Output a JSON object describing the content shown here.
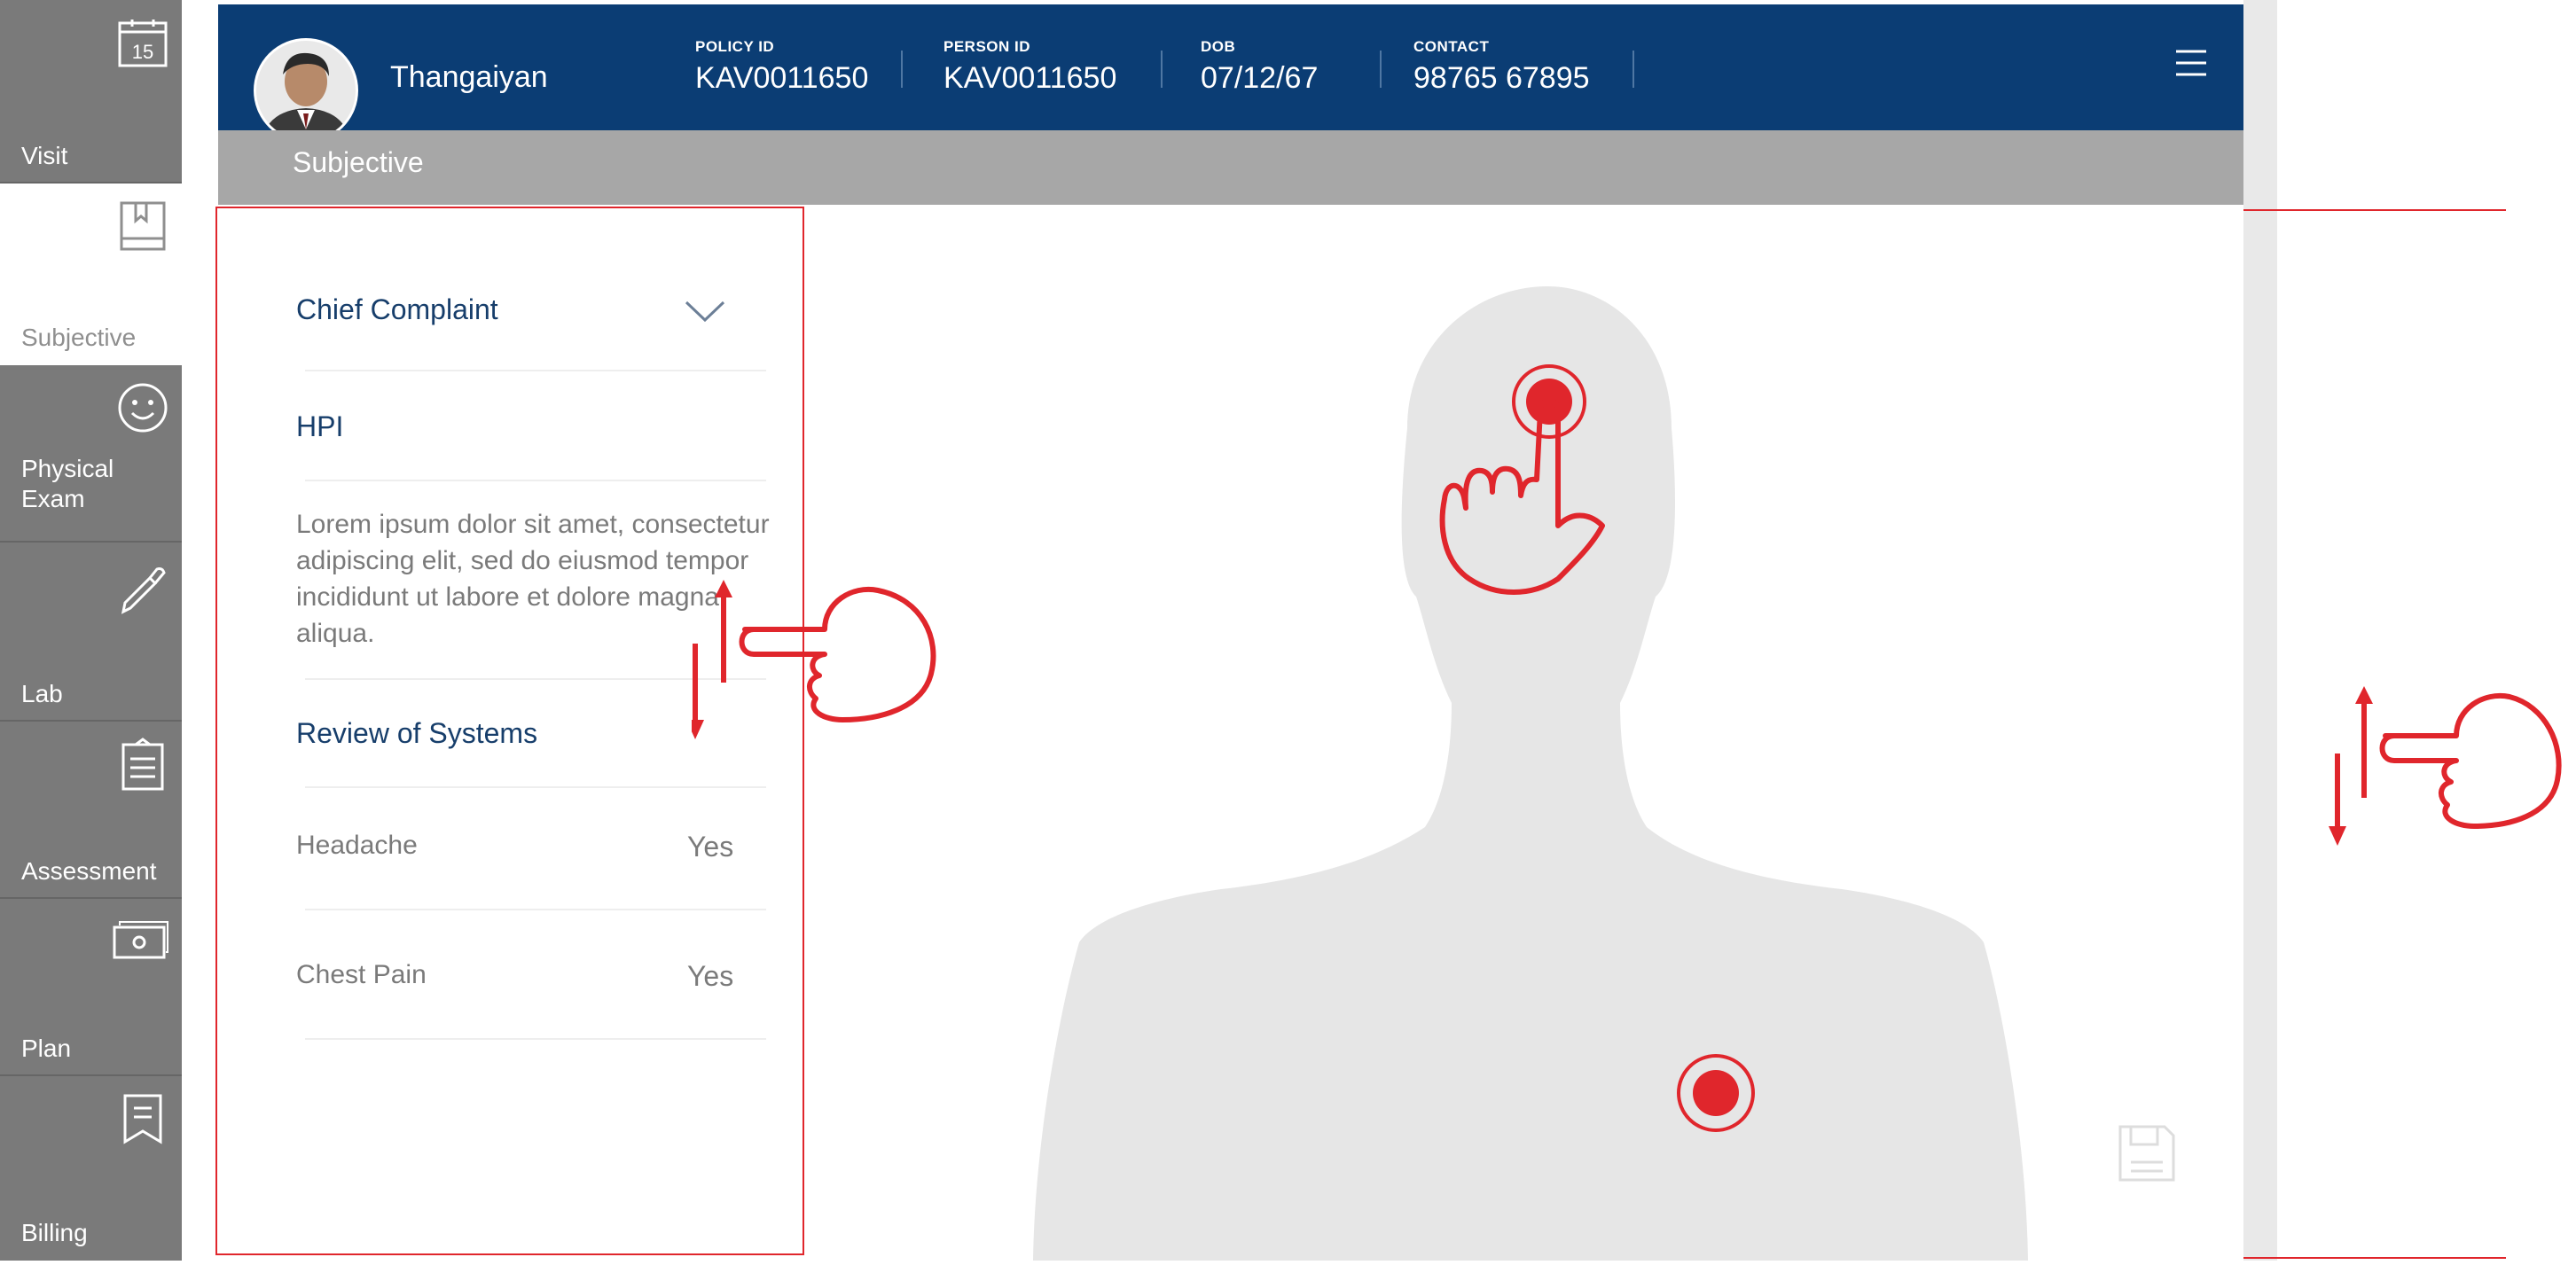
{
  "sidebar": {
    "items": [
      {
        "label": "Visit",
        "icon": "calendar-icon",
        "day": "15",
        "active": false
      },
      {
        "label": "Subjective",
        "icon": "book-icon",
        "active": true
      },
      {
        "label": "Physical\nExam",
        "icon": "smiley-icon",
        "active": false
      },
      {
        "label": "Lab",
        "icon": "pipette-icon",
        "active": false
      },
      {
        "label": "Assessment",
        "icon": "clipboard-icon",
        "active": false
      },
      {
        "label": "Plan",
        "icon": "cash-icon",
        "active": false
      },
      {
        "label": "Billing",
        "icon": "bookmark-icon",
        "active": false
      }
    ]
  },
  "header": {
    "patient_name": "Thangaiyan",
    "fields": [
      {
        "label": "POLICY ID",
        "value": "KAV0011650"
      },
      {
        "label": "PERSON ID",
        "value": "KAV0011650"
      },
      {
        "label": "DOB",
        "value": "07/12/67"
      },
      {
        "label": "CONTACT",
        "value": "98765 67895"
      }
    ],
    "menu_icon": "hamburger-icon"
  },
  "subheader": {
    "title": "Subjective"
  },
  "panel": {
    "chief_complaint": "Chief Complaint",
    "hpi_title": "HPI",
    "hpi_text": "Lorem ipsum dolor sit amet, consectetur adipiscing elit, sed do eiusmod tempor incididunt ut labore et dolore magna aliqua.",
    "ros_title": "Review of Systems",
    "ros_items": [
      {
        "name": "Headache",
        "value": "Yes"
      },
      {
        "name": "Chest Pain",
        "value": "Yes"
      }
    ]
  },
  "colors": {
    "header": "#0b3d74",
    "sidebar": "#7a7a7a",
    "subheader": "#a7a7a7",
    "annotation": "#e0262c",
    "silhouette": "#e6e6e6"
  }
}
